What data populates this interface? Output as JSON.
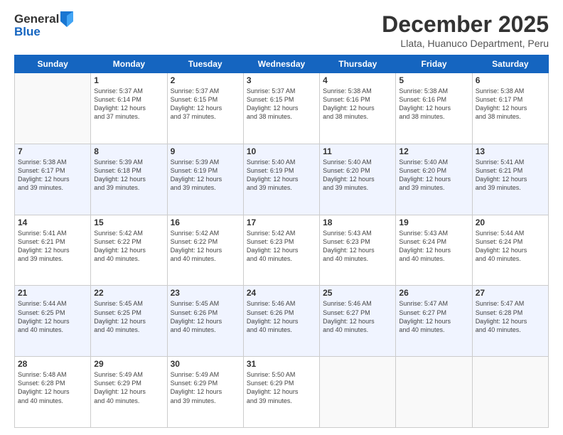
{
  "logo": {
    "general": "General",
    "blue": "Blue"
  },
  "header": {
    "month_title": "December 2025",
    "location": "Llata, Huanuco Department, Peru"
  },
  "weekdays": [
    "Sunday",
    "Monday",
    "Tuesday",
    "Wednesday",
    "Thursday",
    "Friday",
    "Saturday"
  ],
  "rows": [
    [
      {
        "day": "",
        "sunrise": "",
        "sunset": "",
        "daylight": ""
      },
      {
        "day": "1",
        "sunrise": "Sunrise: 5:37 AM",
        "sunset": "Sunset: 6:14 PM",
        "daylight": "Daylight: 12 hours and 37 minutes."
      },
      {
        "day": "2",
        "sunrise": "Sunrise: 5:37 AM",
        "sunset": "Sunset: 6:15 PM",
        "daylight": "Daylight: 12 hours and 37 minutes."
      },
      {
        "day": "3",
        "sunrise": "Sunrise: 5:37 AM",
        "sunset": "Sunset: 6:15 PM",
        "daylight": "Daylight: 12 hours and 38 minutes."
      },
      {
        "day": "4",
        "sunrise": "Sunrise: 5:38 AM",
        "sunset": "Sunset: 6:16 PM",
        "daylight": "Daylight: 12 hours and 38 minutes."
      },
      {
        "day": "5",
        "sunrise": "Sunrise: 5:38 AM",
        "sunset": "Sunset: 6:16 PM",
        "daylight": "Daylight: 12 hours and 38 minutes."
      },
      {
        "day": "6",
        "sunrise": "Sunrise: 5:38 AM",
        "sunset": "Sunset: 6:17 PM",
        "daylight": "Daylight: 12 hours and 38 minutes."
      }
    ],
    [
      {
        "day": "7",
        "sunrise": "Sunrise: 5:38 AM",
        "sunset": "Sunset: 6:17 PM",
        "daylight": "Daylight: 12 hours and 39 minutes."
      },
      {
        "day": "8",
        "sunrise": "Sunrise: 5:39 AM",
        "sunset": "Sunset: 6:18 PM",
        "daylight": "Daylight: 12 hours and 39 minutes."
      },
      {
        "day": "9",
        "sunrise": "Sunrise: 5:39 AM",
        "sunset": "Sunset: 6:19 PM",
        "daylight": "Daylight: 12 hours and 39 minutes."
      },
      {
        "day": "10",
        "sunrise": "Sunrise: 5:40 AM",
        "sunset": "Sunset: 6:19 PM",
        "daylight": "Daylight: 12 hours and 39 minutes."
      },
      {
        "day": "11",
        "sunrise": "Sunrise: 5:40 AM",
        "sunset": "Sunset: 6:20 PM",
        "daylight": "Daylight: 12 hours and 39 minutes."
      },
      {
        "day": "12",
        "sunrise": "Sunrise: 5:40 AM",
        "sunset": "Sunset: 6:20 PM",
        "daylight": "Daylight: 12 hours and 39 minutes."
      },
      {
        "day": "13",
        "sunrise": "Sunrise: 5:41 AM",
        "sunset": "Sunset: 6:21 PM",
        "daylight": "Daylight: 12 hours and 39 minutes."
      }
    ],
    [
      {
        "day": "14",
        "sunrise": "Sunrise: 5:41 AM",
        "sunset": "Sunset: 6:21 PM",
        "daylight": "Daylight: 12 hours and 39 minutes."
      },
      {
        "day": "15",
        "sunrise": "Sunrise: 5:42 AM",
        "sunset": "Sunset: 6:22 PM",
        "daylight": "Daylight: 12 hours and 40 minutes."
      },
      {
        "day": "16",
        "sunrise": "Sunrise: 5:42 AM",
        "sunset": "Sunset: 6:22 PM",
        "daylight": "Daylight: 12 hours and 40 minutes."
      },
      {
        "day": "17",
        "sunrise": "Sunrise: 5:42 AM",
        "sunset": "Sunset: 6:23 PM",
        "daylight": "Daylight: 12 hours and 40 minutes."
      },
      {
        "day": "18",
        "sunrise": "Sunrise: 5:43 AM",
        "sunset": "Sunset: 6:23 PM",
        "daylight": "Daylight: 12 hours and 40 minutes."
      },
      {
        "day": "19",
        "sunrise": "Sunrise: 5:43 AM",
        "sunset": "Sunset: 6:24 PM",
        "daylight": "Daylight: 12 hours and 40 minutes."
      },
      {
        "day": "20",
        "sunrise": "Sunrise: 5:44 AM",
        "sunset": "Sunset: 6:24 PM",
        "daylight": "Daylight: 12 hours and 40 minutes."
      }
    ],
    [
      {
        "day": "21",
        "sunrise": "Sunrise: 5:44 AM",
        "sunset": "Sunset: 6:25 PM",
        "daylight": "Daylight: 12 hours and 40 minutes."
      },
      {
        "day": "22",
        "sunrise": "Sunrise: 5:45 AM",
        "sunset": "Sunset: 6:25 PM",
        "daylight": "Daylight: 12 hours and 40 minutes."
      },
      {
        "day": "23",
        "sunrise": "Sunrise: 5:45 AM",
        "sunset": "Sunset: 6:26 PM",
        "daylight": "Daylight: 12 hours and 40 minutes."
      },
      {
        "day": "24",
        "sunrise": "Sunrise: 5:46 AM",
        "sunset": "Sunset: 6:26 PM",
        "daylight": "Daylight: 12 hours and 40 minutes."
      },
      {
        "day": "25",
        "sunrise": "Sunrise: 5:46 AM",
        "sunset": "Sunset: 6:27 PM",
        "daylight": "Daylight: 12 hours and 40 minutes."
      },
      {
        "day": "26",
        "sunrise": "Sunrise: 5:47 AM",
        "sunset": "Sunset: 6:27 PM",
        "daylight": "Daylight: 12 hours and 40 minutes."
      },
      {
        "day": "27",
        "sunrise": "Sunrise: 5:47 AM",
        "sunset": "Sunset: 6:28 PM",
        "daylight": "Daylight: 12 hours and 40 minutes."
      }
    ],
    [
      {
        "day": "28",
        "sunrise": "Sunrise: 5:48 AM",
        "sunset": "Sunset: 6:28 PM",
        "daylight": "Daylight: 12 hours and 40 minutes."
      },
      {
        "day": "29",
        "sunrise": "Sunrise: 5:49 AM",
        "sunset": "Sunset: 6:29 PM",
        "daylight": "Daylight: 12 hours and 40 minutes."
      },
      {
        "day": "30",
        "sunrise": "Sunrise: 5:49 AM",
        "sunset": "Sunset: 6:29 PM",
        "daylight": "Daylight: 12 hours and 39 minutes."
      },
      {
        "day": "31",
        "sunrise": "Sunrise: 5:50 AM",
        "sunset": "Sunset: 6:29 PM",
        "daylight": "Daylight: 12 hours and 39 minutes."
      },
      {
        "day": "",
        "sunrise": "",
        "sunset": "",
        "daylight": ""
      },
      {
        "day": "",
        "sunrise": "",
        "sunset": "",
        "daylight": ""
      },
      {
        "day": "",
        "sunrise": "",
        "sunset": "",
        "daylight": ""
      }
    ]
  ]
}
